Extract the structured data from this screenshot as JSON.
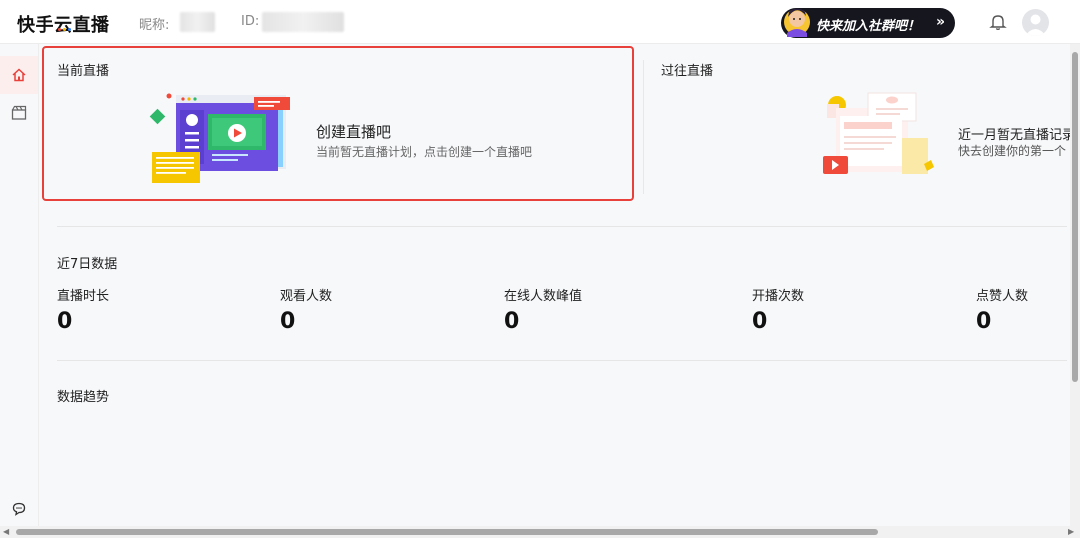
{
  "header": {
    "logo_text": "快手云直播",
    "nickname_label": "昵称:",
    "id_label": "ID:",
    "banner_text": "快来加入社群吧！",
    "banner_arrow": "»"
  },
  "sidebar": {
    "items": [
      {
        "icon": "home-icon",
        "active": true
      },
      {
        "icon": "film-icon",
        "active": false
      },
      {
        "icon": "chat-icon",
        "active": false
      }
    ]
  },
  "current_live": {
    "title": "当前直播",
    "create_title": "创建直播吧",
    "create_subtitle": "当前暂无直播计划，点击创建一个直播吧"
  },
  "past_live": {
    "title": "过往直播",
    "empty_title": "近一月暂无直播记录",
    "empty_subtitle": "快去创建你的第一个"
  },
  "stats": {
    "title": "近7日数据",
    "items": [
      {
        "label": "直播时长",
        "value": "0"
      },
      {
        "label": "观看人数",
        "value": "0"
      },
      {
        "label": "在线人数峰值",
        "value": "0"
      },
      {
        "label": "开播次数",
        "value": "0"
      },
      {
        "label": "点赞人数",
        "value": "0"
      }
    ]
  },
  "trend": {
    "title": "数据趋势"
  },
  "colors": {
    "accent": "#e8403a",
    "banner_bg": "#15161e",
    "illustration_purple": "#6c4fe0",
    "illustration_green": "#2fb86a"
  }
}
